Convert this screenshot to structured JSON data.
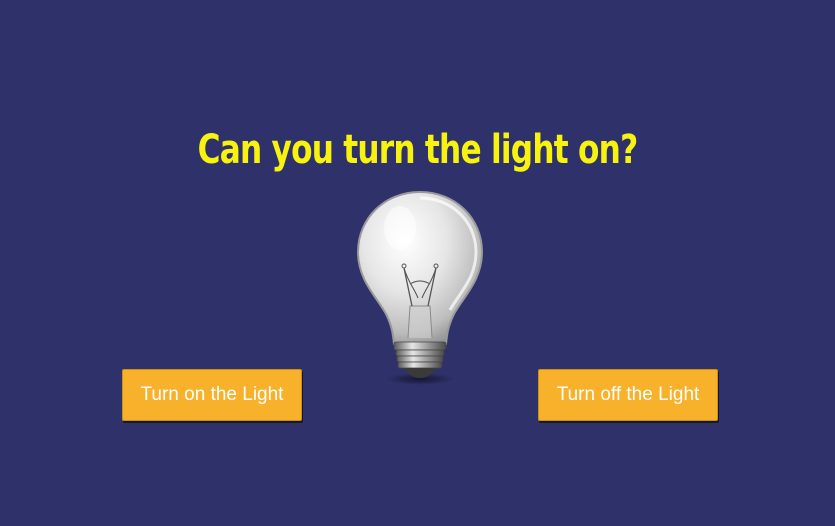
{
  "page": {
    "title": "Can you turn the light on?",
    "background_color": "#2f316b",
    "title_color": "#f7f30f"
  },
  "bulb": {
    "icon": "lightbulb-icon",
    "state": "off"
  },
  "buttons": {
    "on_label": "Turn on the Light",
    "off_label": "Turn off the Light",
    "color": "#f7b12a"
  }
}
